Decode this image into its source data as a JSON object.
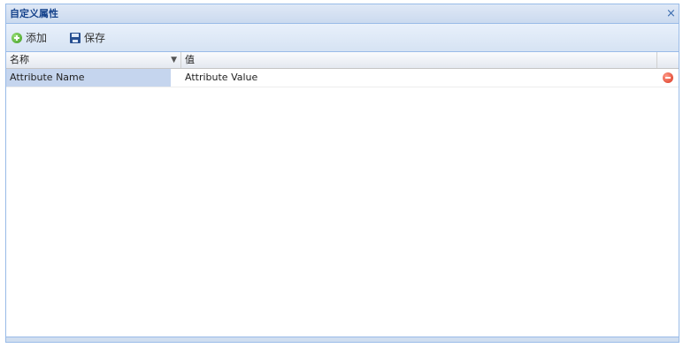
{
  "window": {
    "title": "自定义属性",
    "close_symbol": "×"
  },
  "toolbar": {
    "add_label": "添加",
    "add_icon": "add-icon",
    "save_label": "保存",
    "save_icon": "save-icon"
  },
  "grid": {
    "columns": [
      "名称",
      "值"
    ],
    "rows": [
      {
        "name": "Attribute Name",
        "value": "Attribute Value"
      }
    ]
  },
  "colors": {
    "title_text": "#15428b",
    "border": "#99bbe8",
    "selected_cell": "#c5d5ee"
  }
}
